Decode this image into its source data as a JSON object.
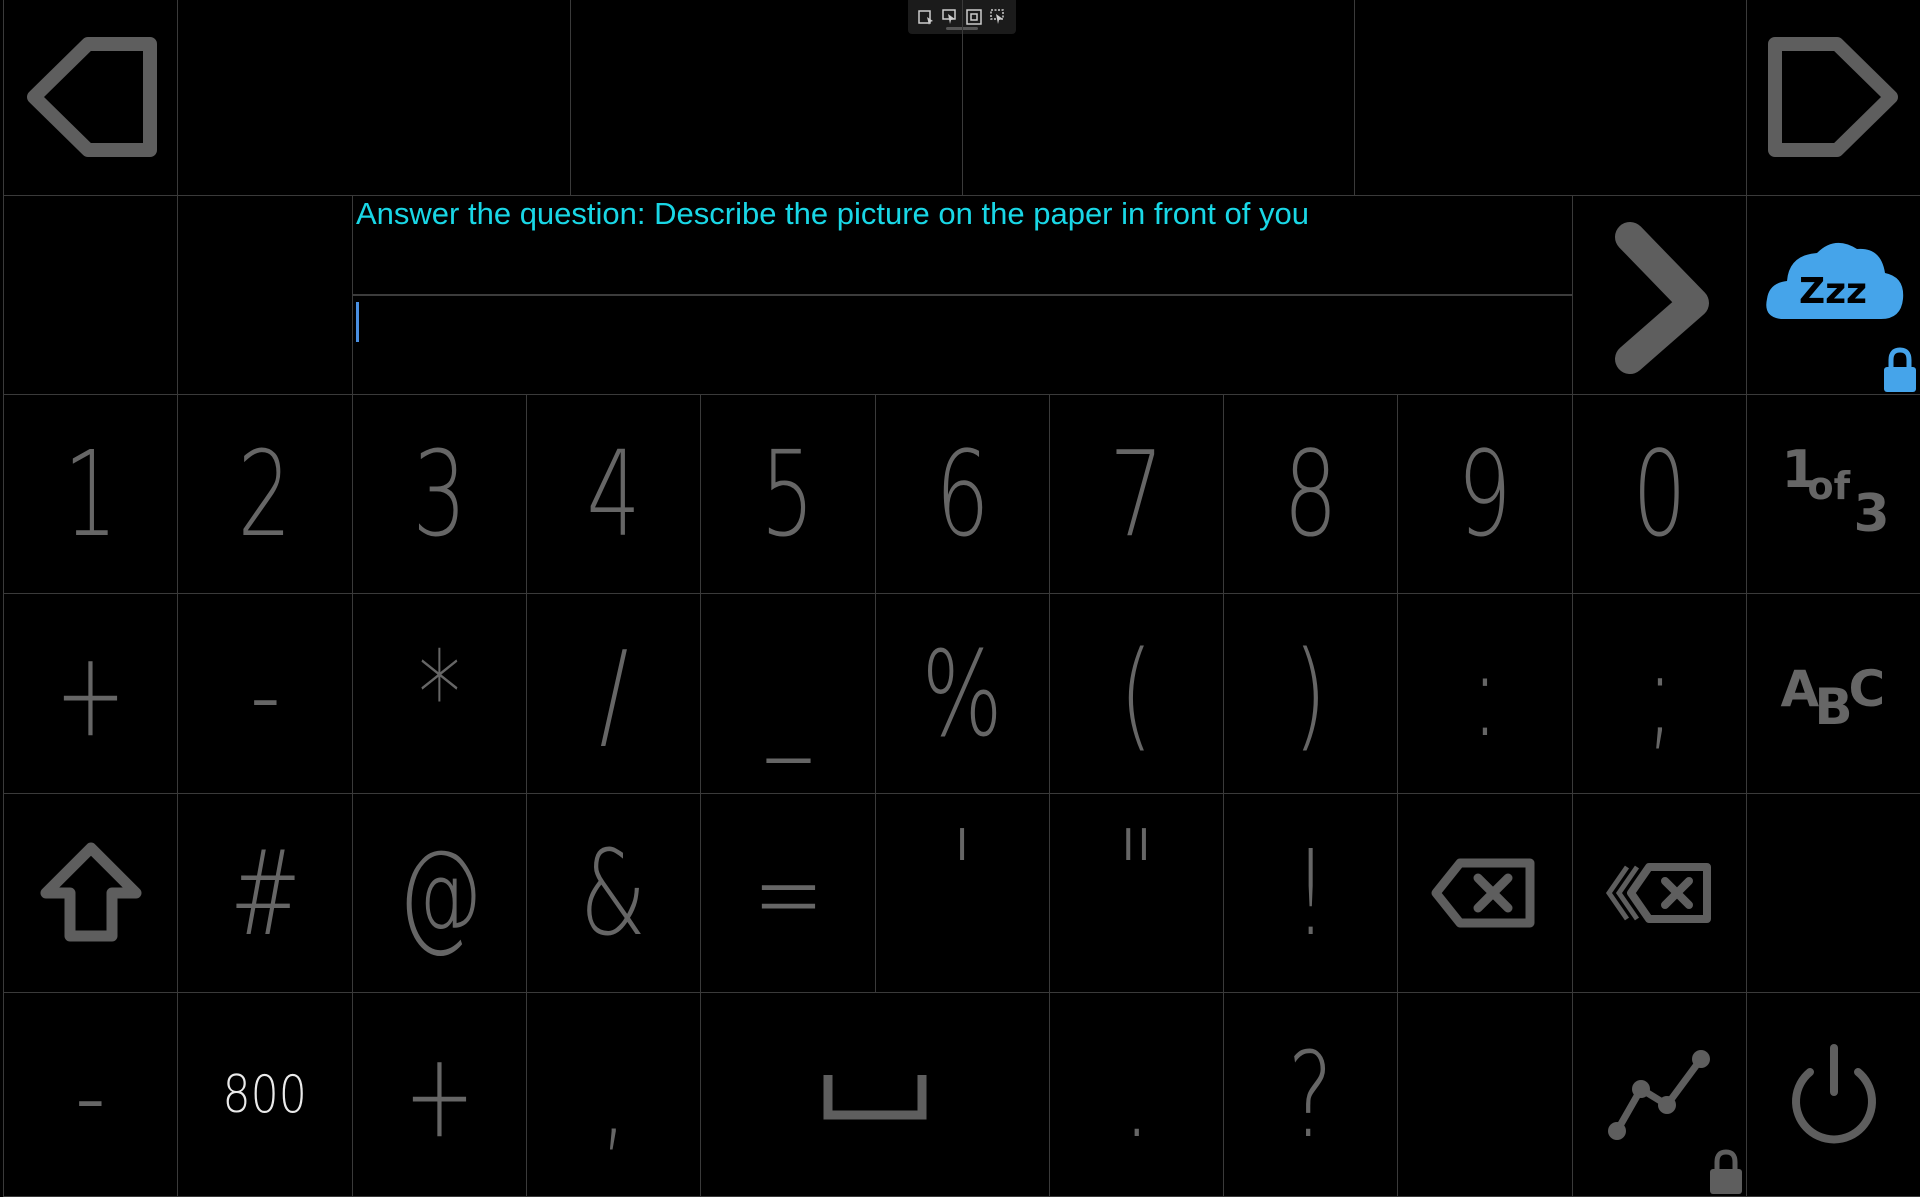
{
  "toolbar": {
    "icons": [
      "select-icon",
      "pointer-icon",
      "window-icon",
      "settings-pointer-icon"
    ]
  },
  "top_row": {
    "back_icon": "back-arrow-icon",
    "forward_icon": "forward-arrow-icon"
  },
  "prompt": {
    "text": "Answer the question: Describe the picture on the paper in front of you"
  },
  "input": {
    "value": ""
  },
  "side": {
    "next_icon": "chevron-right-icon",
    "sleep_icon": "sleep-cloud-icon",
    "sleep_label": "Zzz",
    "lock_icon": "lock-icon"
  },
  "keyboard": {
    "row1": [
      "1",
      "2",
      "3",
      "4",
      "5",
      "6",
      "7",
      "8",
      "9",
      "0"
    ],
    "page_indicator": {
      "num": "1",
      "of": "of",
      "total": "3"
    },
    "row2": [
      "+",
      "-",
      "*",
      "/",
      "_",
      "%",
      "(",
      ")",
      ":",
      ";"
    ],
    "abc_label": {
      "a": "A",
      "b": "B",
      "c": "C"
    },
    "row3": [
      "#",
      "@",
      "&",
      "=",
      "'",
      "\"",
      "!"
    ],
    "row4": {
      "dash": "-",
      "number": "800",
      "plus": "+",
      "comma": ",",
      "period": ".",
      "question": "?"
    },
    "colors": {
      "keys": "#666666",
      "grid": "#3a3a3a",
      "prompt": "#19d7e6",
      "accent": "#4aa3e8"
    }
  }
}
